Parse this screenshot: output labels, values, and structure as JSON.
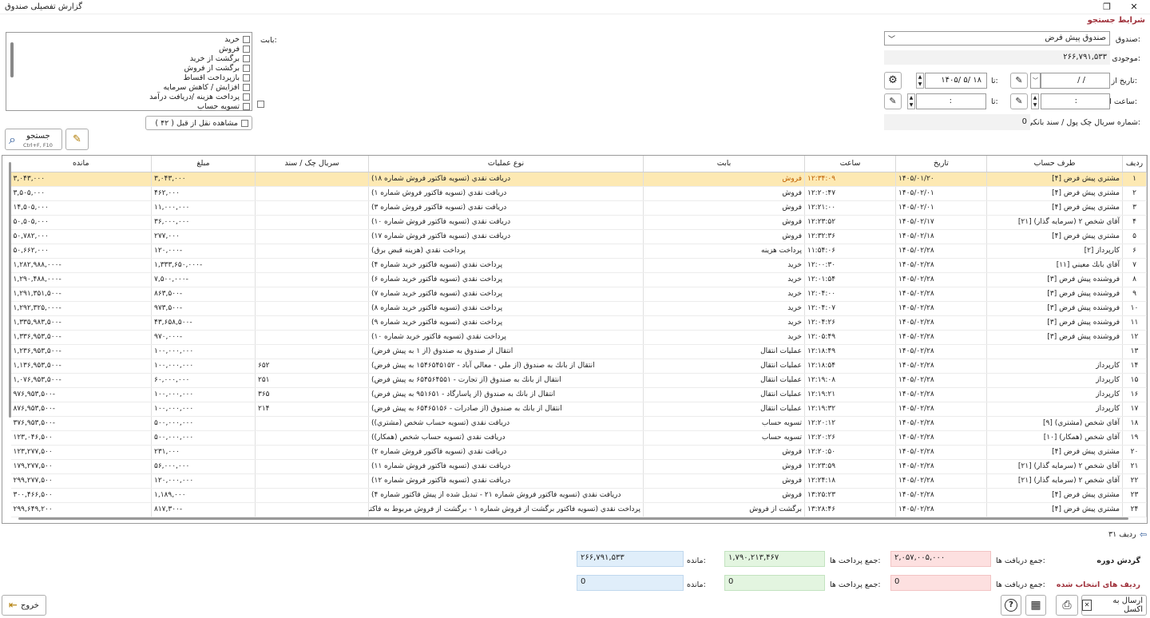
{
  "window": {
    "title": "گزارش تفصیلی صندوق",
    "maximize": "❐",
    "close": "✕"
  },
  "search_section": {
    "title": "شرایط جستجو"
  },
  "fund": {
    "label": "صندوق:",
    "value": "صندوق پیش فرض"
  },
  "balance": {
    "label": "موجودی:",
    "value": "۲۶۶,۷۹۱,۵۳۳"
  },
  "date": {
    "from_label": "تاریخ از:",
    "to_label": "تا:",
    "from_value": "/     /",
    "to_value": "۱۴۰۵/ ۵/ ۱۸"
  },
  "time": {
    "from_label": "ساعت از:",
    "to_label": "تا:",
    "from_value": ":",
    "to_value": ":"
  },
  "serial": {
    "label": "شماره سریال چک پول / سند بانکی:",
    "value": "0"
  },
  "category": {
    "label": "بابت:",
    "items": [
      "خرید",
      "فروش",
      "برگشت از خرید",
      "برگشت از فروش",
      "بازپرداخت اقساط",
      "افزایش / کاهش سرمایه",
      "پرداخت هزینه /دریافت درآمد",
      "تسویه حساب"
    ]
  },
  "transfer": {
    "label": "مشاهده نقل از قبل ( ۴۲ )"
  },
  "search_button": {
    "label": "جستجو",
    "shortcut": "Ctrl+F, F10"
  },
  "table": {
    "headers": [
      "ردیف",
      "طرف حساب",
      "تاریخ",
      "ساعت",
      "بابت",
      "نوع عملیات",
      "سریال چک / سند",
      "مبلغ",
      "مانده"
    ],
    "rows": [
      [
        "۱",
        "مشتري پیش فرض [۴]",
        "۱۴۰۵/۰۱/۲۰",
        "۱۲:۳۴:۰۹",
        "فروش",
        "دریافت نقدي (تسويه فاکتور فروش شماره ۱۸)",
        "",
        "۳,۰۴۳,۰۰۰",
        "۳,۰۴۳,۰۰۰"
      ],
      [
        "۲",
        "مشتري پیش فرض [۴]",
        "۱۴۰۵/۰۲/۰۱",
        "۱۲:۲۰:۴۷",
        "فروش",
        "دریافت نقدي (تسويه فاکتور فروش شماره ۱)",
        "",
        "۴۶۲,۰۰۰",
        "۳,۵۰۵,۰۰۰"
      ],
      [
        "۳",
        "مشتري پیش فرض [۴]",
        "۱۴۰۵/۰۲/۰۱",
        "۱۲:۲۱:۰۰",
        "فروش",
        "دریافت نقدي (تسويه فاکتور فروش شماره ۳)",
        "",
        "۱۱,۰۰۰,۰۰۰",
        "۱۴,۵۰۵,۰۰۰"
      ],
      [
        "۴",
        "آقاي شخص ۲ (سرمایه گذار) [۲۱]",
        "۱۴۰۵/۰۲/۱۷",
        "۱۲:۲۳:۵۲",
        "فروش",
        "دریافت نقدي (تسويه فاکتور فروش شماره ۱۰)",
        "",
        "۳۶,۰۰۰,۰۰۰",
        "۵۰,۵۰۵,۰۰۰"
      ],
      [
        "۵",
        "مشتري پیش فرض [۴]",
        "۱۴۰۵/۰۲/۱۸",
        "۱۲:۳۲:۳۶",
        "فروش",
        "دریافت نقدي (تسويه فاکتور فروش شماره ۱۷)",
        "",
        "۲۷۷,۰۰۰",
        "۵۰,۷۸۲,۰۰۰"
      ],
      [
        "۶",
        "کارپرداز [۲]",
        "۱۴۰۵/۰۲/۲۸",
        "۱۱:۵۴:۰۶",
        "پرداخت هزینه",
        "پرداخت نقدي (هزینه قبض برق)",
        "",
        "-۱۲۰,۰۰۰",
        "۵۰,۶۶۲,۰۰۰"
      ],
      [
        "۷",
        "آقاي بابك معيني [۱۱]",
        "۱۴۰۵/۰۲/۲۸",
        "۱۲:۰۰:۳۰",
        "خرید",
        "پرداخت نقدي (تسويه فاکتور خريد شماره ۴)",
        "",
        "-۱,۳۳۳,۶۵۰,۰۰۰",
        "-۱,۲۸۲,۹۸۸,۰۰۰"
      ],
      [
        "۸",
        "فروشنده پیش فرض [۳]",
        "۱۴۰۵/۰۲/۲۸",
        "۱۲:۰۱:۵۴",
        "خرید",
        "پرداخت نقدي (تسويه فاکتور خريد شماره ۶)",
        "",
        "-۷,۵۰۰,۰۰۰",
        "-۱,۲۹۰,۴۸۸,۰۰۰"
      ],
      [
        "۹",
        "فروشنده پیش فرض [۳]",
        "۱۴۰۵/۰۲/۲۸",
        "۱۲:۰۴:۰۰",
        "خرید",
        "پرداخت نقدي (تسويه فاکتور خريد شماره ۷)",
        "",
        "-۸۶۳,۵۰۰",
        "-۱,۲۹۱,۳۵۱,۵۰۰"
      ],
      [
        "۱۰",
        "فروشنده پیش فرض [۳]",
        "۱۴۰۵/۰۲/۲۸",
        "۱۲:۰۴:۰۷",
        "خرید",
        "پرداخت نقدي (تسويه فاکتور خريد شماره ۸)",
        "",
        "-۹۷۳,۵۰۰",
        "-۱,۲۹۲,۳۲۵,۰۰۰"
      ],
      [
        "۱۱",
        "فروشنده پیش فرض [۳]",
        "۱۴۰۵/۰۲/۲۸",
        "۱۲:۰۴:۲۶",
        "خرید",
        "پرداخت نقدي (تسويه فاکتور خريد شماره ۹)",
        "",
        "-۴۳,۶۵۸,۵۰۰",
        "-۱,۳۳۵,۹۸۳,۵۰۰"
      ],
      [
        "۱۲",
        "فروشنده پیش فرض [۳]",
        "۱۴۰۵/۰۲/۲۸",
        "۱۲:۰۵:۴۹",
        "خرید",
        "پرداخت نقدي (تسويه فاکتور خريد شماره ۱۰)",
        "",
        "-۹۷۰,۰۰۰",
        "-۱,۳۳۶,۹۵۳,۵۰۰"
      ],
      [
        "۱۳",
        "",
        "۱۴۰۵/۰۲/۲۸",
        "۱۲:۱۸:۴۹",
        "عملیات انتقال",
        "انتقال از صندوق به صندوق (از ۱ به پیش فرض)",
        "",
        "۱۰۰,۰۰۰,۰۰۰",
        "-۱,۲۳۶,۹۵۳,۵۰۰"
      ],
      [
        "۱۴",
        "کارپرداز",
        "۱۴۰۵/۰۲/۲۸",
        "۱۲:۱۸:۵۴",
        "عملیات انتقال",
        "انتقال از بانك به صندوق (از ملي - معالي آباد - ۱۵۴۶۵۴۵۱۵۲ به پیش فرض)",
        "۶۵۲",
        "۱۰۰,۰۰۰,۰۰۰",
        "-۱,۱۳۶,۹۵۳,۵۰۰"
      ],
      [
        "۱۵",
        "کارپرداز",
        "۱۴۰۵/۰۲/۲۸",
        "۱۲:۱۹:۰۸",
        "عملیات انتقال",
        "انتقال از بانك به صندوق (از تجارت - ۶۵۴۵۶۴۵۵۱ به پیش فرض)",
        "۲۵۱",
        "۶۰,۰۰۰,۰۰۰",
        "-۱,۰۷۶,۹۵۳,۵۰۰"
      ],
      [
        "۱۶",
        "کارپرداز",
        "۱۴۰۵/۰۲/۲۸",
        "۱۲:۱۹:۲۱",
        "عملیات انتقال",
        "انتقال از بانك به صندوق (از پاسارگاد - ۹۵۱۶۵۱ به پیش فرض)",
        "۳۶۵",
        "۱۰۰,۰۰۰,۰۰۰",
        "-۹۷۶,۹۵۳,۵۰۰"
      ],
      [
        "۱۷",
        "کارپرداز",
        "۱۴۰۵/۰۲/۲۸",
        "۱۲:۱۹:۳۲",
        "عملیات انتقال",
        "انتقال از بانك به صندوق (از صادرات - ۶۵۴۶۵۱۵۶ به پیش فرض)",
        "۲۱۴",
        "۱۰۰,۰۰۰,۰۰۰",
        "-۸۷۶,۹۵۳,۵۰۰"
      ],
      [
        "۱۸",
        "آقاي شخص (مشتري) [۹]",
        "۱۴۰۵/۰۲/۲۸",
        "۱۲:۲۰:۱۲",
        "تسویه حساب",
        "دریافت نقدي (تسويه حساب شخص (مشتري))",
        "",
        "۵۰۰,۰۰۰,۰۰۰",
        "-۳۷۶,۹۵۳,۵۰۰"
      ],
      [
        "۱۹",
        "آقاي شخص (همكار) [۱۰]",
        "۱۴۰۵/۰۲/۲۸",
        "۱۲:۲۰:۲۶",
        "تسویه حساب",
        "دریافت نقدي (تسويه حساب شخص (همكار))",
        "",
        "۵۰۰,۰۰۰,۰۰۰",
        "۱۲۳,۰۴۶,۵۰۰"
      ],
      [
        "۲۰",
        "مشتري پیش فرض [۴]",
        "۱۴۰۵/۰۲/۲۸",
        "۱۲:۲۰:۵۰",
        "فروش",
        "دریافت نقدي (تسويه فاکتور فروش شماره ۲)",
        "",
        "۲۳۱,۰۰۰",
        "۱۲۳,۲۷۷,۵۰۰"
      ],
      [
        "۲۱",
        "آقاي شخص ۲ (سرمایه گذار) [۲۱]",
        "۱۴۰۵/۰۲/۲۸",
        "۱۲:۲۳:۵۹",
        "فروش",
        "دریافت نقدي (تسويه فاکتور فروش شماره ۱۱)",
        "",
        "۵۶,۰۰۰,۰۰۰",
        "۱۷۹,۲۷۷,۵۰۰"
      ],
      [
        "۲۲",
        "آقاي شخص ۲ (سرمایه گذار) [۲۱]",
        "۱۴۰۵/۰۲/۲۸",
        "۱۲:۲۴:۱۸",
        "فروش",
        "دریافت نقدي (تسويه فاکتور فروش شماره ۱۲)",
        "",
        "۱۲۰,۰۰۰,۰۰۰",
        "۲۹۹,۲۷۷,۵۰۰"
      ],
      [
        "۲۳",
        "مشتري پیش فرض [۴]",
        "۱۴۰۵/۰۲/۲۸",
        "۱۳:۲۵:۲۳",
        "فروش",
        "دریافت نقدي (تسويه فاکتور فروش شماره ۲۱ - تبدیل شده از پیش فاکتور شماره ۴)",
        "",
        "۱,۱۸۹,۰۰۰",
        "۳۰۰,۴۶۶,۵۰۰"
      ],
      [
        "۲۴",
        "مشتري پیش فرض [۴]",
        "۱۴۰۵/۰۲/۲۸",
        "۱۳:۲۸:۴۶",
        "برگشت از فروش",
        "پرداخت نقدي (تسويه فاکتور برگشت از فروش شماره ۱ - برگشت از فروش مربوط به فاکتور فروش",
        "",
        "-۸۱۷,۳۰۰",
        "۲۹۹,۶۴۹,۲۰۰"
      ]
    ]
  },
  "row_count": "۳۱ ردیف",
  "period": {
    "label": "گردش دوره",
    "receipts_label": "جمع دریافت ها:",
    "receipts": "۲,۰۵۷,۰۰۵,۰۰۰",
    "payments_label": "جمع پرداخت ها:",
    "payments": "۱,۷۹۰,۲۱۳,۴۶۷",
    "balance_label": "مانده:",
    "balance": "۲۶۶,۷۹۱,۵۳۳"
  },
  "selected": {
    "label": "ردیف های انتخاب شده",
    "receipts_label": "جمع دریافت ها:",
    "receipts": "0",
    "payments_label": "جمع پرداخت ها:",
    "payments": "0",
    "balance_label": "مانده:",
    "balance": "0"
  },
  "actions": {
    "excel": "ارسال به اکسل",
    "exit": "خروج"
  }
}
